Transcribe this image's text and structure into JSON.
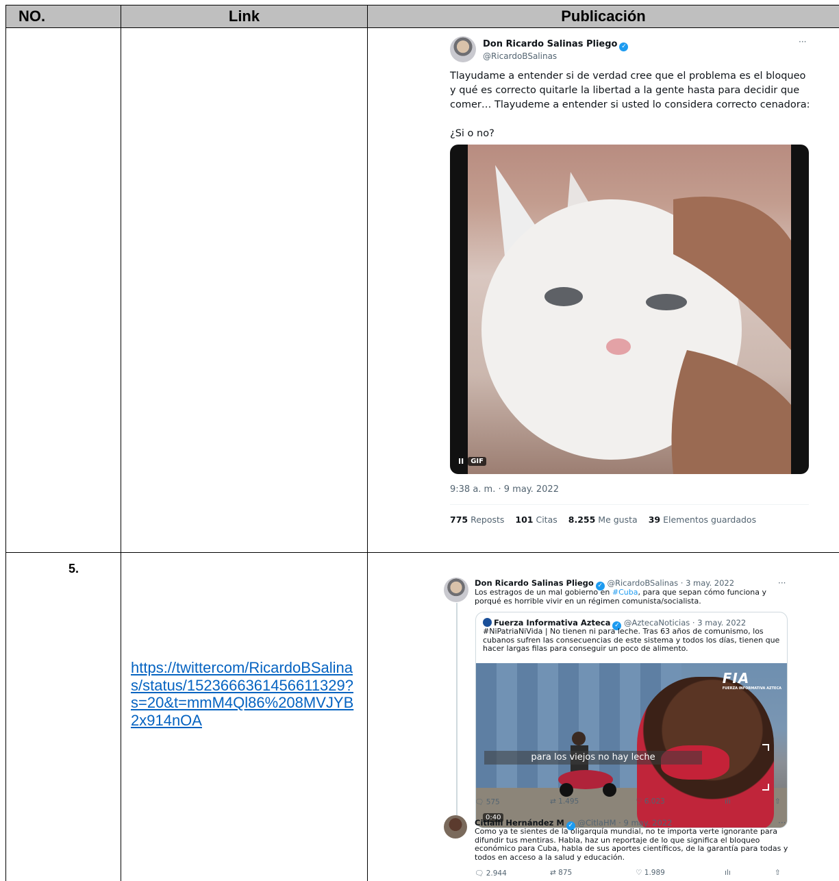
{
  "table": {
    "headers": {
      "no": "NO.",
      "link": "Link",
      "publicacion": "Publicación"
    },
    "row2": {
      "number": "5.",
      "link": "https://twittercom/RicardoBSalinas/status/1523666361456611329?s=20&t=mmM4Ql86%208MVJYB2x914nOA"
    }
  },
  "tweet1": {
    "name": "Don Ricardo Salinas Pliego",
    "handle": "@RicardoBSalinas",
    "more": "···",
    "text_p1": "Tlayudame a entender si de verdad cree que el problema es el bloqueo y qué es correcto quitarle la libertad a la gente hasta para decidir que comer… Tlayudeme a entender si usted lo considera correcto cenadora:",
    "text_p2": "¿Si o no?",
    "gif_label": "GIF",
    "pause": "II",
    "timestamp": "9:38 a. m. · 9 may. 2022",
    "stats": {
      "reposts_n": "775",
      "reposts_l": "Reposts",
      "citas_n": "101",
      "citas_l": "Citas",
      "likes_n": "8.255",
      "likes_l": "Me gusta",
      "saved_n": "39",
      "saved_l": "Elementos guardados"
    }
  },
  "tweet2": {
    "name": "Don Ricardo Salinas Pliego",
    "meta": "@RicardoBSalinas · 3 may. 2022",
    "more": "···",
    "text_a": "Los estragos de un mal gobierno en ",
    "hashtag": "#Cuba",
    "text_b": ", para que sepan cómo funciona y porqué es horrible vivir en un régimen comunista/socialista.",
    "quote": {
      "name": "Fuerza Informativa Azteca",
      "meta": "@AztecaNoticias · 3 may. 2022",
      "text": "#NiPatriaNiVida | No tienen ni para leche. Tras 63 años de comunismo, los cubanos sufren las consecuencias de este sistema y todos los días, tienen que hacer largas filas para conseguir un poco de alimento.",
      "logo": "FIA",
      "logo_sub": "FUERZA INFORMATIVA AZTECA",
      "caption": "para los viejos no hay leche",
      "duration": "0:40"
    },
    "actions": {
      "replies": "575",
      "reposts": "1.495",
      "likes": "6.023"
    }
  },
  "reply": {
    "name": "Citlalli Hernández M",
    "meta": "@CitlaHM · 9 may. 2022",
    "more": "···",
    "text": "Como ya te sientes de la oligarquía mundial, no te importa verte ignorante para difundir tus mentiras. Habla, haz un reportaje de lo que significa el bloqueo económico para Cuba, habla de sus aportes científicos, de la garantía para todas y todos en acceso a la salud y educación.",
    "actions": {
      "replies": "2.944",
      "reposts": "875",
      "likes": "1.989"
    }
  }
}
